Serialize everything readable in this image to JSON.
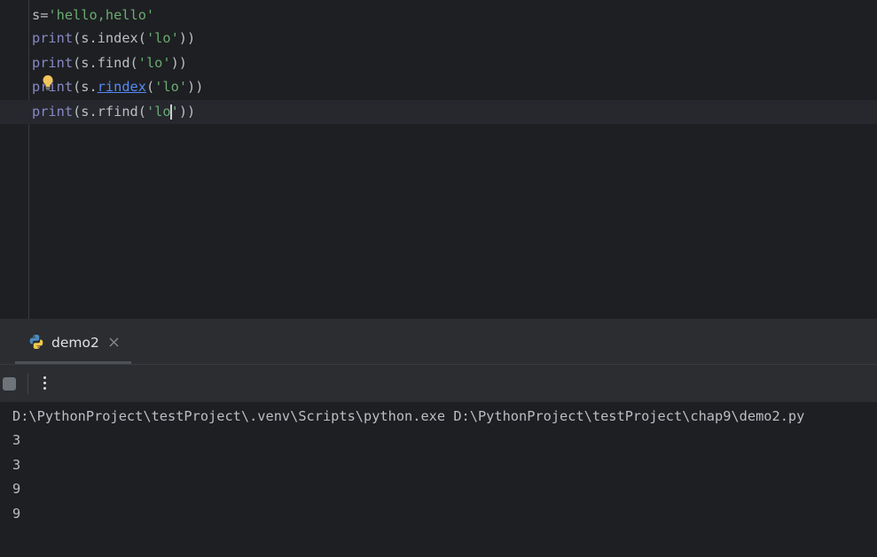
{
  "editor": {
    "lines": [
      [
        {
          "text": "s=",
          "kind": "plain"
        },
        {
          "text": "'hello,hello'",
          "kind": "string"
        }
      ],
      [
        {
          "text": "print",
          "kind": "builtin"
        },
        {
          "text": "(s.index(",
          "kind": "plain"
        },
        {
          "text": "'lo'",
          "kind": "string"
        },
        {
          "text": "))",
          "kind": "plain"
        }
      ],
      [
        {
          "text": "print",
          "kind": "builtin"
        },
        {
          "text": "(s.find(",
          "kind": "plain"
        },
        {
          "text": "'lo'",
          "kind": "string"
        },
        {
          "text": "))",
          "kind": "plain"
        }
      ],
      [
        {
          "text": "print",
          "kind": "builtin"
        },
        {
          "text": "(s.",
          "kind": "plain"
        },
        {
          "text": "rindex",
          "kind": "link"
        },
        {
          "text": "(",
          "kind": "plain"
        },
        {
          "text": "'lo'",
          "kind": "string"
        },
        {
          "text": "))",
          "kind": "plain"
        }
      ],
      [
        {
          "text": "print",
          "kind": "builtin"
        },
        {
          "text": "(s.rfind(",
          "kind": "plain"
        },
        {
          "text": "'lo",
          "kind": "string"
        },
        {
          "text": "",
          "kind": "caret"
        },
        {
          "text": "'",
          "kind": "string"
        },
        {
          "text": "))",
          "kind": "plain"
        }
      ]
    ],
    "current_line": 5,
    "intention_icon": "lightbulb-icon"
  },
  "run_panel": {
    "tab": {
      "label": "demo2",
      "icon": "python-icon",
      "close_icon": "close-icon"
    },
    "toolbar": {
      "stop_icon": "stop-icon",
      "more_icon": "more-vertical-icon"
    },
    "console": {
      "lines": [
        "D:\\PythonProject\\testProject\\.venv\\Scripts\\python.exe D:\\PythonProject\\testProject\\chap9\\demo2.py",
        "3",
        "3",
        "9",
        "9"
      ]
    }
  },
  "colors": {
    "background": "#1e1f22",
    "panel": "#2b2d30",
    "builtin": "#8888c6",
    "string": "#6aab73",
    "text": "#bcbec4",
    "link": "#548af7"
  }
}
